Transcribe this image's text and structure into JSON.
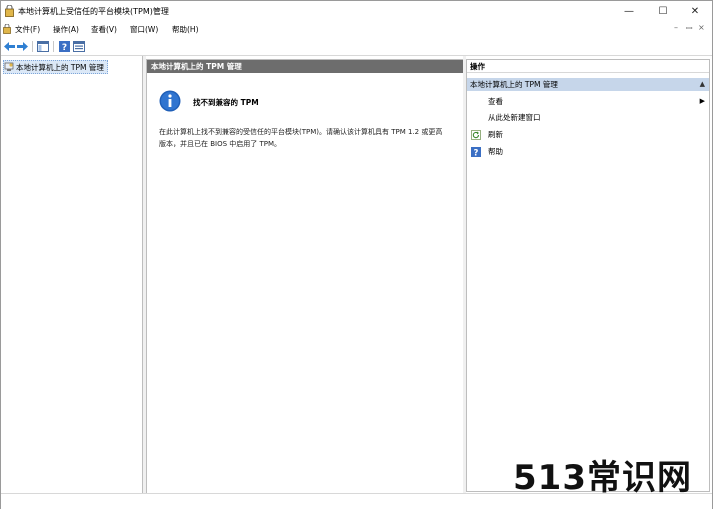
{
  "window": {
    "title": "本地计算机上受信任的平台模块(TPM)管理",
    "minimize_glyph": "—",
    "maximize_glyph": "☐",
    "close_glyph": "✕"
  },
  "menubar": {
    "items": [
      {
        "label": "文件(F)"
      },
      {
        "label": "操作(A)"
      },
      {
        "label": "查看(V)"
      },
      {
        "label": "窗口(W)"
      },
      {
        "label": "帮助(H)"
      }
    ],
    "mdi_min": "–",
    "mdi_restore": "ꟷ",
    "mdi_close": "×"
  },
  "toolbar": {
    "icons": [
      "back-arrow-icon",
      "forward-arrow-icon",
      "show-hide-tree-icon",
      "help-icon",
      "mmc-view-icon"
    ]
  },
  "tree": {
    "item_label": "本地计算机上的 TPM 管理"
  },
  "center": {
    "header": "本地计算机上的 TPM 管理",
    "info_title": "找不到兼容的 TPM",
    "info_desc": "在此计算机上找不到兼容的受信任的平台模块(TPM)。请确认该计算机具有 TPM 1.2 或更高版本，并且已在 BIOS 中启用了 TPM。"
  },
  "actions": {
    "header": "操作",
    "section": "本地计算机上的 TPM 管理",
    "collapse_glyph": "▲",
    "items": [
      {
        "label": "查看",
        "has_submenu": true,
        "arrow": "▶"
      },
      {
        "label": "从此处新建窗口",
        "has_submenu": false
      },
      {
        "label": "刷新",
        "has_submenu": false
      },
      {
        "label": "帮助",
        "has_submenu": false
      }
    ]
  },
  "watermark": "513常识网",
  "colors": {
    "center_header_bg": "#6d6d6d",
    "action_section_bg": "#c6d6ea",
    "tree_selected_bg": "#dbe8f7",
    "info_icon_blue": "#1f5fb8"
  }
}
